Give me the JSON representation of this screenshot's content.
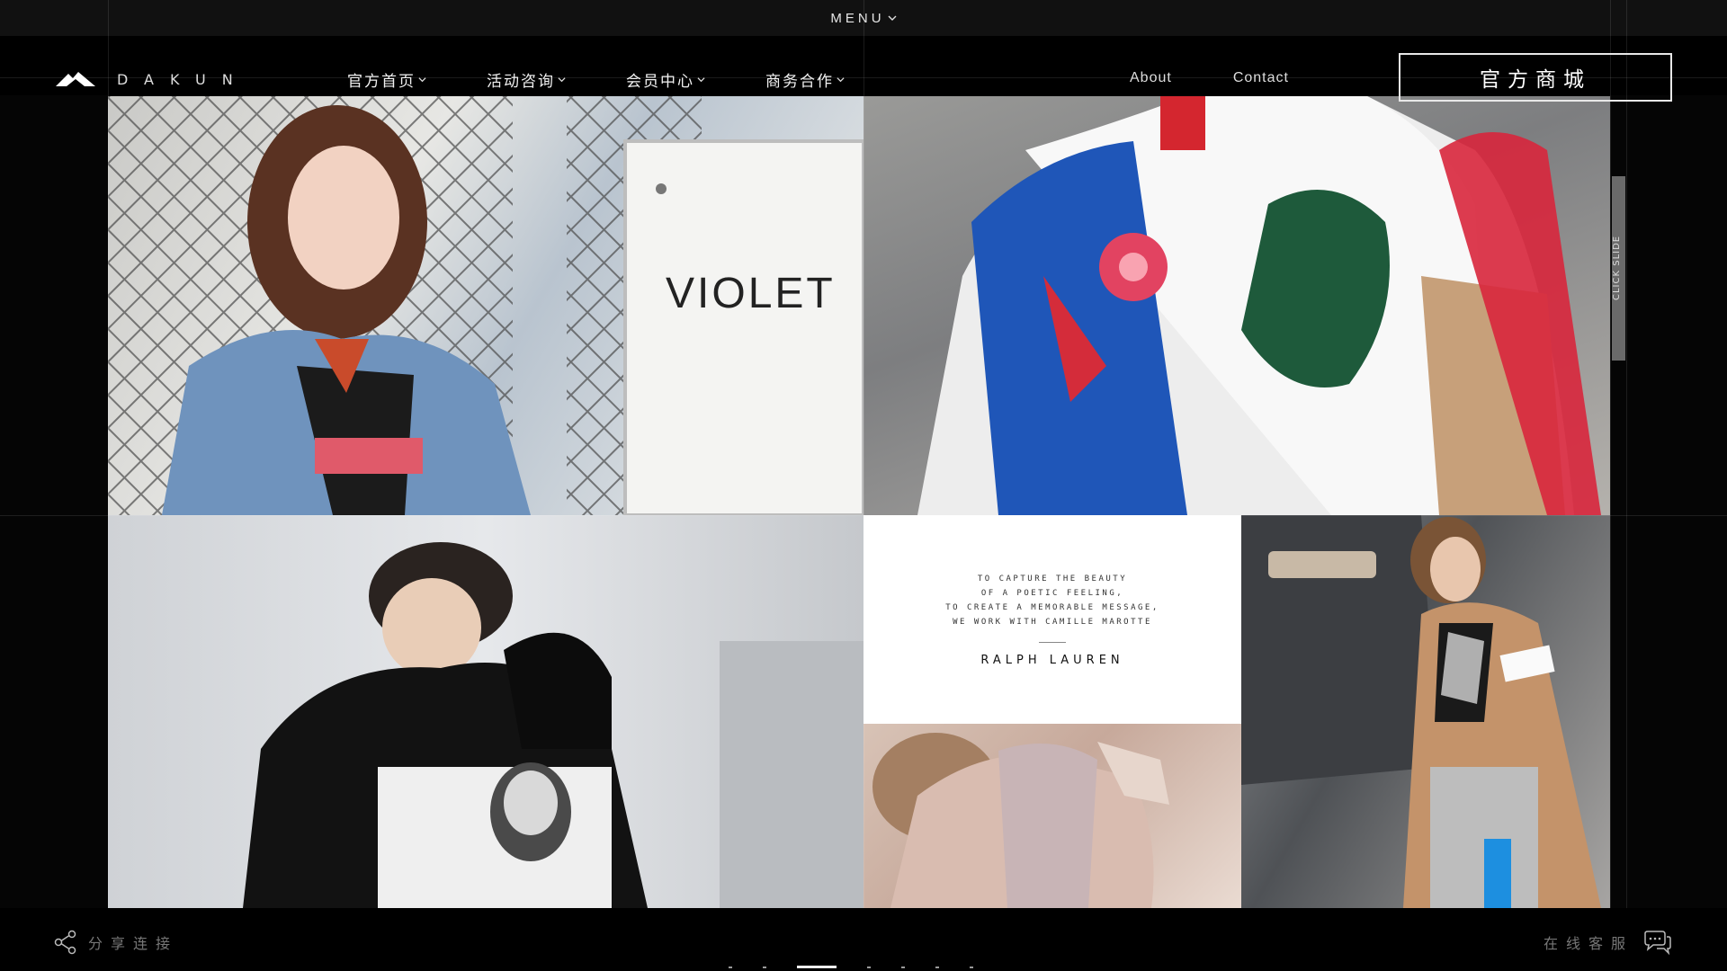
{
  "menu": {
    "label": "MENU"
  },
  "brand": {
    "name": "DAKUN"
  },
  "nav": {
    "items": [
      {
        "label": "官方首页"
      },
      {
        "label": "活动咨询"
      },
      {
        "label": "会员中心"
      },
      {
        "label": "商务合作"
      }
    ],
    "about": "About",
    "contact": "Contact",
    "shop_button": "官方商城"
  },
  "tiles": {
    "violet_sign": "VIOLET",
    "quote_lines": [
      "TO CAPTURE THE BEAUTY",
      "OF A POETIC FEELING,",
      "TO CREATE A MEMORABLE MESSAGE,",
      "WE WORK WITH CAMILLE MAROTTE"
    ],
    "quote_brand": "RALPH LAUREN"
  },
  "side": {
    "slide_label": "CLICK SLIDE"
  },
  "footer": {
    "share": "分享连接",
    "service": "在线客服",
    "pager_count": 7,
    "pager_active": 2
  }
}
